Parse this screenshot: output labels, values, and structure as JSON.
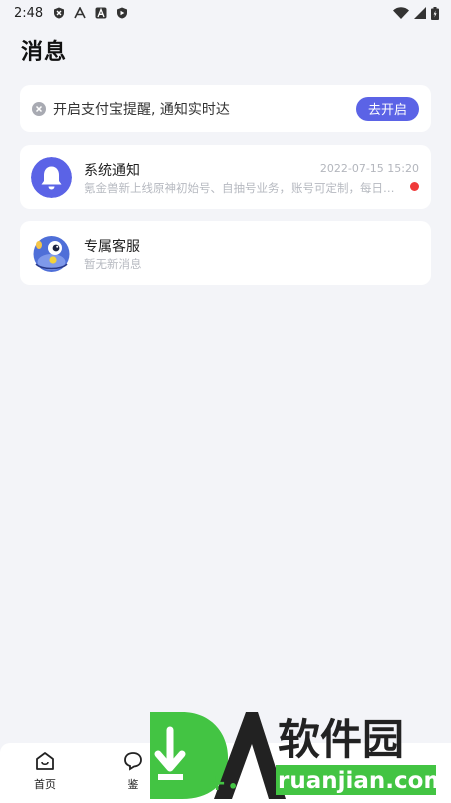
{
  "status_bar": {
    "time": "2:48",
    "icons": [
      "shield-x-icon",
      "app-a-icon",
      "app-a-box-icon",
      "shield-play-icon"
    ],
    "right_icons": [
      "wifi-icon",
      "signal-icon",
      "battery-icon"
    ]
  },
  "page": {
    "title": "消息"
  },
  "notice": {
    "text": "开启支付宝提醒, 通知实时达",
    "button_label": "去开启",
    "accent_color": "#5b63e6"
  },
  "messages": [
    {
      "title": "系统通知",
      "time": "2022-07-15 15:20",
      "preview": "氪金兽新上线原神初始号、自抽号业务，账号可定制，每日…",
      "unread": true,
      "avatar": "bell-icon"
    },
    {
      "title": "专属客服",
      "time": "",
      "preview": "暂无新消息",
      "unread": false,
      "avatar": "mascot-avatar"
    }
  ],
  "bottom_nav": {
    "items": [
      {
        "label": "首页",
        "icon": "home-icon"
      },
      {
        "label": "鉴",
        "icon": "chat-icon"
      }
    ]
  },
  "watermark": {
    "logo_text": "软件园",
    "domain": "ruanjian.com",
    "color": "#43c443"
  }
}
